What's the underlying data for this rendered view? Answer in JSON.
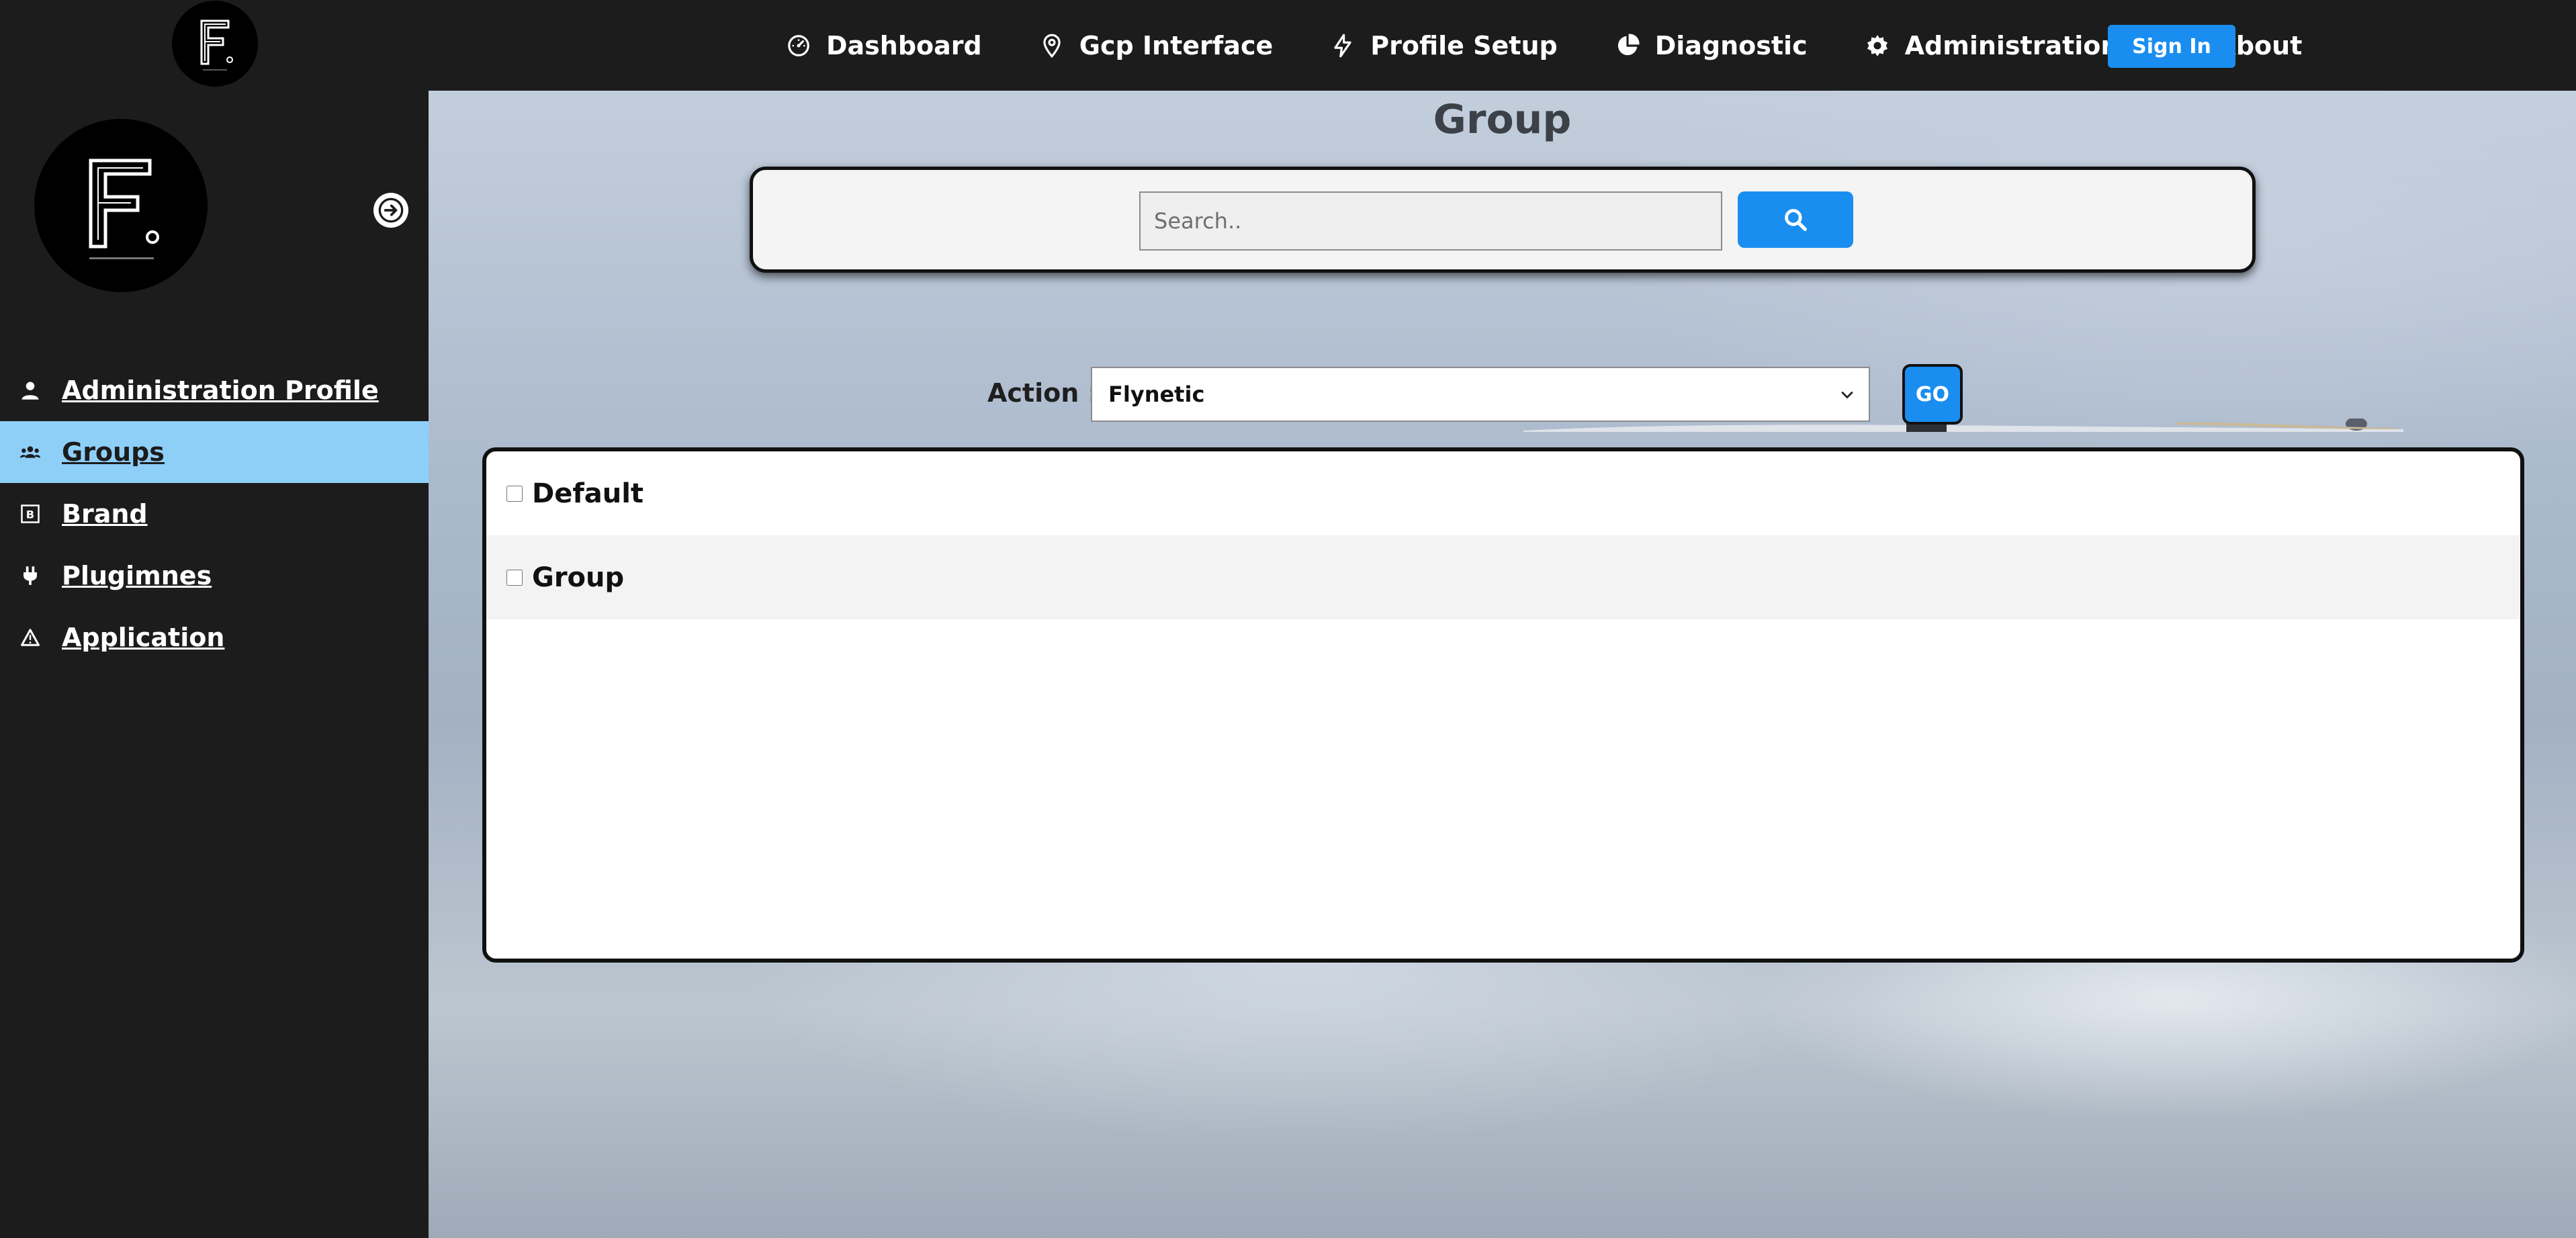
{
  "navbar": {
    "items": [
      {
        "label": "Dashboard",
        "icon": "gauge-icon"
      },
      {
        "label": "Gcp Interface",
        "icon": "map-pin-icon"
      },
      {
        "label": "Profile Setup",
        "icon": "lightning-icon"
      },
      {
        "label": "Diagnostic",
        "icon": "pie-chart-icon"
      },
      {
        "label": "Administration",
        "icon": "gear-icon"
      },
      {
        "label": "About",
        "icon": "info-icon"
      }
    ],
    "sign_in_label": "Sign In"
  },
  "sidebar": {
    "items": [
      {
        "label": "Administration Profile",
        "icon": "user-icon",
        "active": false
      },
      {
        "label": "Groups",
        "icon": "users-icon",
        "active": true
      },
      {
        "label": "Brand",
        "icon": "brand-icon",
        "active": false
      },
      {
        "label": "Plugimnes",
        "icon": "plug-icon",
        "active": false
      },
      {
        "label": "Application",
        "icon": "warning-triangle-icon",
        "active": false
      }
    ]
  },
  "main": {
    "title": "Group",
    "search": {
      "placeholder": "Search..",
      "value": ""
    },
    "action": {
      "label": "Action :",
      "selected": "Flynetic",
      "go_label": "GO"
    },
    "groups": [
      {
        "label": "Default",
        "checked": false
      },
      {
        "label": "Group",
        "checked": false
      }
    ]
  },
  "colors": {
    "dark_bg": "#1c1c1c",
    "accent_blue": "#1a8ef0",
    "active_sidebar": "#8ecff8"
  }
}
